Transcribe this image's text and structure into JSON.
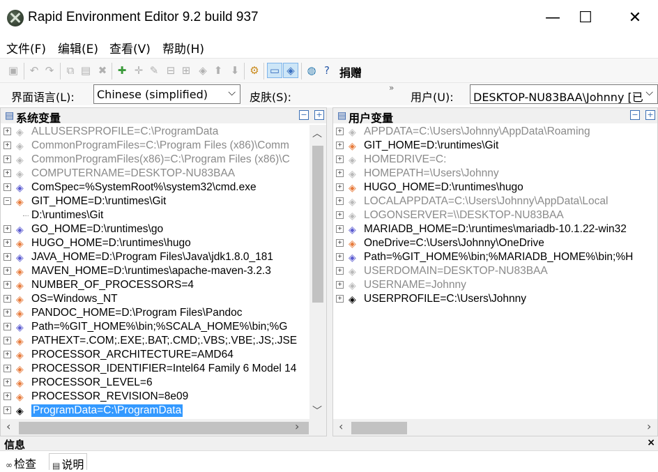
{
  "window": {
    "title": "Rapid Environment Editor 9.2 build 937",
    "minimize": "—",
    "maximize": "☐",
    "close": "✕"
  },
  "menu": [
    "文件(F)",
    "编辑(E)",
    "查看(V)",
    "帮助(H)"
  ],
  "toolbar": {
    "donate_label": "捐赠"
  },
  "options": {
    "language_label": "界面语言(L):",
    "language_value": "Chinese (simplified)",
    "skin_label": "皮肤(S):",
    "user_label": "用户(U):",
    "user_value": "DESKTOP-NU83BAA\\Johnny [已"
  },
  "system_pane": {
    "title": "系统变量",
    "rows": [
      {
        "text": "ALLUSERSPROFILE=C:\\ProgramData",
        "style": "grey",
        "expander": "+"
      },
      {
        "text": "CommonProgramFiles=C:\\Program Files (x86)\\Comm",
        "style": "grey",
        "expander": "+"
      },
      {
        "text": "CommonProgramFiles(x86)=C:\\Program Files (x86)\\C",
        "style": "grey",
        "expander": "+"
      },
      {
        "text": "COMPUTERNAME=DESKTOP-NU83BAA",
        "style": "grey",
        "expander": "+"
      },
      {
        "text": "ComSpec=%SystemRoot%\\system32\\cmd.exe",
        "style": "blue",
        "expander": "+"
      },
      {
        "text": "GIT_HOME=D:\\runtimes\\Git",
        "style": "orange",
        "expander": "−"
      },
      {
        "text": "D:\\runtimes\\Git",
        "style": "child",
        "expander": ""
      },
      {
        "text": "GO_HOME=D:\\runtimes\\go",
        "style": "blue",
        "expander": "+"
      },
      {
        "text": "HUGO_HOME=D:\\runtimes\\hugo",
        "style": "orange",
        "expander": "+"
      },
      {
        "text": "JAVA_HOME=D:\\Program Files\\Java\\jdk1.8.0_181",
        "style": "blue",
        "expander": "+"
      },
      {
        "text": "MAVEN_HOME=D:\\runtimes\\apache-maven-3.2.3",
        "style": "orange",
        "expander": "+"
      },
      {
        "text": "NUMBER_OF_PROCESSORS=4",
        "style": "orange",
        "expander": "+"
      },
      {
        "text": "OS=Windows_NT",
        "style": "orange",
        "expander": "+"
      },
      {
        "text": "PANDOC_HOME=D:\\Program Files\\Pandoc",
        "style": "orange",
        "expander": "+"
      },
      {
        "text": "Path=%GIT_HOME%\\bin;%SCALA_HOME%\\bin;%G",
        "style": "blue",
        "expander": "+"
      },
      {
        "text": "PATHEXT=.COM;.EXE;.BAT;.CMD;.VBS;.VBE;.JS;.JSE",
        "style": "orange",
        "expander": "+"
      },
      {
        "text": "PROCESSOR_ARCHITECTURE=AMD64",
        "style": "orange",
        "expander": "+"
      },
      {
        "text": "PROCESSOR_IDENTIFIER=Intel64 Family 6 Model 14",
        "style": "orange",
        "expander": "+"
      },
      {
        "text": "PROCESSOR_LEVEL=6",
        "style": "orange",
        "expander": "+"
      },
      {
        "text": "PROCESSOR_REVISION=8e09",
        "style": "orange",
        "expander": "+"
      },
      {
        "text": "ProgramData=C:\\ProgramData",
        "style": "sel",
        "expander": "+"
      }
    ]
  },
  "user_pane": {
    "title": "用户变量",
    "rows": [
      {
        "text": "APPDATA=C:\\Users\\Johnny\\AppData\\Roaming",
        "style": "grey",
        "expander": "+"
      },
      {
        "text": "GIT_HOME=D:\\runtimes\\Git",
        "style": "orange",
        "expander": "+"
      },
      {
        "text": "HOMEDRIVE=C:",
        "style": "grey",
        "expander": "+"
      },
      {
        "text": "HOMEPATH=\\Users\\Johnny",
        "style": "grey",
        "expander": "+"
      },
      {
        "text": "HUGO_HOME=D:\\runtimes\\hugo",
        "style": "orange",
        "expander": "+"
      },
      {
        "text": "LOCALAPPDATA=C:\\Users\\Johnny\\AppData\\Local",
        "style": "grey",
        "expander": "+"
      },
      {
        "text": "LOGONSERVER=\\\\DESKTOP-NU83BAA",
        "style": "grey",
        "expander": "+"
      },
      {
        "text": "MARIADB_HOME=D:\\runtimes\\mariadb-10.1.22-win32",
        "style": "blue",
        "expander": "+"
      },
      {
        "text": "OneDrive=C:\\Users\\Johnny\\OneDrive",
        "style": "orange",
        "expander": "+"
      },
      {
        "text": "Path=%GIT_HOME%\\bin;%MARIADB_HOME%\\bin;%H",
        "style": "blue",
        "expander": "+"
      },
      {
        "text": "USERDOMAIN=DESKTOP-NU83BAA",
        "style": "grey",
        "expander": "+"
      },
      {
        "text": "USERNAME=Johnny",
        "style": "grey",
        "expander": "+"
      },
      {
        "text": "USERPROFILE=C:\\Users\\Johnny",
        "style": "plain",
        "expander": "+"
      }
    ]
  },
  "info": {
    "title": "信息",
    "close": "×"
  },
  "bottom_tabs": [
    "检查",
    "说明"
  ]
}
